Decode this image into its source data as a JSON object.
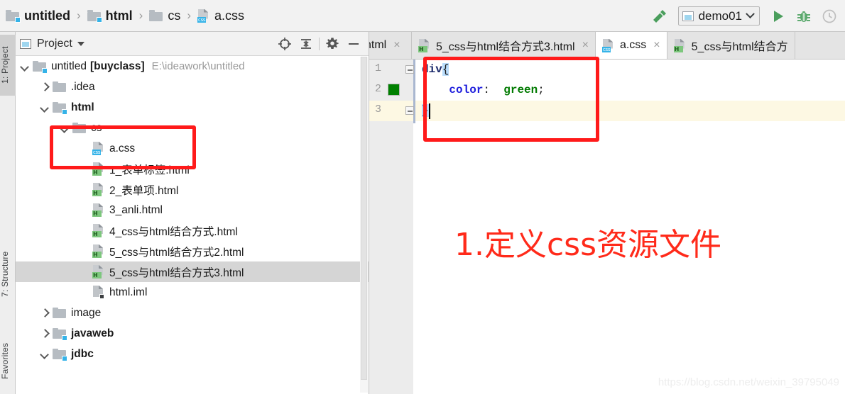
{
  "breadcrumb": {
    "items": [
      {
        "label": "untitled",
        "icon": "module-folder-icon",
        "bold": true
      },
      {
        "label": "html",
        "icon": "module-folder-icon",
        "bold": true
      },
      {
        "label": "cs",
        "icon": "folder-icon",
        "bold": false
      },
      {
        "label": "a.css",
        "icon": "css-file-icon",
        "bold": false
      }
    ],
    "separator": "›"
  },
  "toolbar": {
    "build_icon": "hammer-icon",
    "run_config": {
      "label": "demo01",
      "icon": "run-config-icon",
      "chevron": "chevron-down-icon"
    },
    "run_icon": "run-play-icon",
    "debug_icon": "debug-bug-icon",
    "profile_icon": "profiler-clock-icon"
  },
  "left_strip": {
    "tabs": [
      {
        "label": "1: Project",
        "selected": true
      },
      {
        "label": "7: Structure",
        "selected": false
      },
      {
        "label": "Favorites",
        "selected": false
      }
    ]
  },
  "project_panel": {
    "title": "Project",
    "title_caret": "caret-down-icon",
    "header_icons": [
      "locate-target-icon",
      "collapse-all-icon",
      "settings-gear-icon",
      "hide-minimize-icon"
    ],
    "tree": [
      {
        "indent": 0,
        "arrow": "down",
        "icon": "module-folder-icon",
        "label": "untitled",
        "bold_suffix": "[buyclass]",
        "path": "E:\\ideawork\\untitled",
        "selected": false
      },
      {
        "indent": 1,
        "arrow": "right",
        "icon": "folder-icon",
        "label": ".idea",
        "selected": false
      },
      {
        "indent": 1,
        "arrow": "down",
        "icon": "module-folder-icon",
        "label": "html",
        "bold": true,
        "selected": false
      },
      {
        "indent": 2,
        "arrow": "down",
        "icon": "folder-icon",
        "label": "cs",
        "selected": false
      },
      {
        "indent": 3,
        "arrow": "none",
        "icon": "css-file-icon",
        "label": "a.css",
        "selected": false
      },
      {
        "indent": 2,
        "arrow": "none",
        "icon": "html-file-icon",
        "label": "1_表单标签.html",
        "selected": false
      },
      {
        "indent": 2,
        "arrow": "none",
        "icon": "html-file-icon",
        "label": "2_表单项.html",
        "selected": false
      },
      {
        "indent": 2,
        "arrow": "none",
        "icon": "html-file-icon",
        "label": "3_anli.html",
        "selected": false
      },
      {
        "indent": 2,
        "arrow": "none",
        "icon": "html-file-icon",
        "label": "4_css与html结合方式.html",
        "selected": false
      },
      {
        "indent": 2,
        "arrow": "none",
        "icon": "html-file-icon",
        "label": "5_css与html结合方式2.html",
        "selected": false
      },
      {
        "indent": 2,
        "arrow": "none",
        "icon": "html-file-icon",
        "label": "5_css与html结合方式3.html",
        "selected": true
      },
      {
        "indent": 2,
        "arrow": "none",
        "icon": "iml-file-icon",
        "label": "html.iml",
        "selected": false
      },
      {
        "indent": 1,
        "arrow": "right",
        "icon": "folder-icon",
        "label": "image",
        "selected": false
      },
      {
        "indent": 1,
        "arrow": "right",
        "icon": "module-folder-icon",
        "label": "javaweb",
        "bold": true,
        "selected": false
      },
      {
        "indent": 1,
        "arrow": "down",
        "icon": "module-folder-icon",
        "label": "jdbc",
        "bold": true,
        "selected": false
      }
    ]
  },
  "editor": {
    "tabs": [
      {
        "label": "ntml",
        "icon": "none",
        "active": false,
        "clipped_left": true,
        "close": "×"
      },
      {
        "label": "5_css与html结合方式3.html",
        "icon": "html-file-icon",
        "active": false,
        "close": "×"
      },
      {
        "label": "a.css",
        "icon": "css-file-icon",
        "active": true,
        "close": "×"
      },
      {
        "label": "5_css与html结合方",
        "icon": "html-file-icon",
        "active": false,
        "clipped_right": true,
        "close": ""
      }
    ],
    "gutter": {
      "line_numbers": [
        "1",
        "2",
        "3"
      ],
      "color_swatch_line": 2,
      "color_swatch_value": "#008000"
    },
    "code_lines": [
      {
        "n": 1,
        "fold": true,
        "current": false,
        "tokens": [
          {
            "t": "div",
            "c": "element"
          },
          {
            "t": "{",
            "c": "brace-highlight"
          }
        ]
      },
      {
        "n": 2,
        "fold": false,
        "current": false,
        "tokens": [
          {
            "t": "    color",
            "c": "property"
          },
          {
            "t": ":  ",
            "c": "punct"
          },
          {
            "t": "green",
            "c": "value"
          },
          {
            "t": ";",
            "c": "punct"
          }
        ]
      },
      {
        "n": 3,
        "fold": true,
        "current": true,
        "tokens": [
          {
            "t": "}",
            "c": "brace-highlight"
          }
        ]
      }
    ]
  },
  "annotations": {
    "code_box": "red-rectangle-highlight",
    "tree_box": "red-rectangle-highlight",
    "caption": "1.定义css资源文件",
    "caption_color": "#ff2a1a"
  },
  "watermark": "https://blog.csdn.net/weixin_39795049"
}
